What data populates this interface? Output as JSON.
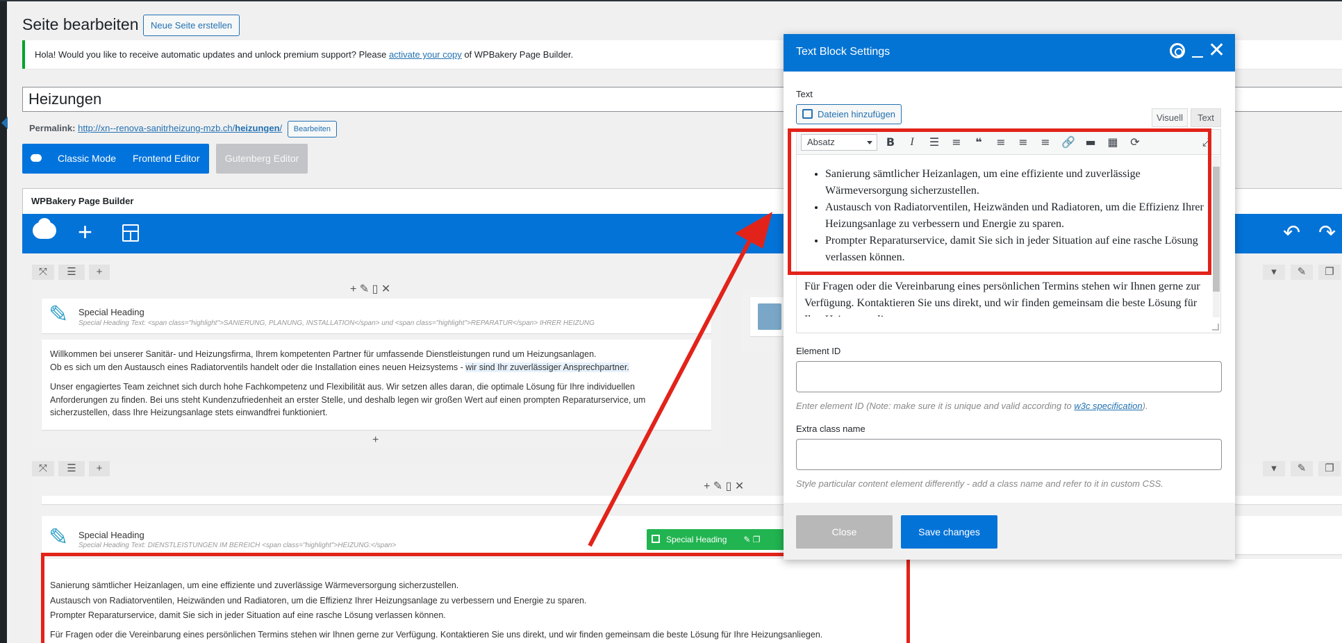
{
  "header": {
    "page_title": "Seite bearbeiten",
    "new_page_label": "Neue Seite erstellen"
  },
  "notice": {
    "text_before": "Hola! Would you like to receive automatic updates and unlock premium support? Please ",
    "link_text": "activate your copy",
    "text_after": " of WPBakery Page Builder."
  },
  "post": {
    "title": "Heizungen",
    "permalink_label": "Permalink:",
    "permalink_base": "http://xn--renova-sanitrheizung-mzb.ch/",
    "permalink_slug": "heizungen",
    "permalink_edit": "Bearbeiten"
  },
  "editor_modes": {
    "classic": "Classic Mode",
    "frontend": "Frontend Editor",
    "gutenberg": "Gutenberg Editor"
  },
  "wpbakery": {
    "title": "WPBakery Page Builder"
  },
  "row1": {
    "heading_title": "Special Heading",
    "heading_sub": "Special Heading Text: <span class=\"highlight\">SANIERUNG, PLANUNG, INSTALLATION</span> und <span class=\"highlight\">REPARATUR</span> IHRER HEIZUNG",
    "p1_line1": "Willkommen bei unserer Sanitär- und Heizungsfirma, Ihrem kompetenten Partner für umfassende Dienstleistungen rund um Heizungsanlagen.",
    "p1_line2_a": "Ob es sich um den Austausch eines Radiatorventils handelt oder die Installation eines neuen Heizsystems - ",
    "p1_line2_hl": "wir sind Ihr zuverlässiger Ansprechpartner.",
    "p2_line1": "Unser engagiertes Team zeichnet sich durch hohe Fachkompetenz und Flexibilität aus. Wir setzen alles daran, die optimale Lösung für Ihre individuellen",
    "p2_line2": "Anforderungen zu finden. Bei uns steht Kundenzufriedenheit an erster Stelle, und deshalb legen wir großen Wert auf einen prompten Reparaturservice, um",
    "p2_line3": "sicherzustellen, dass Ihre Heizungsanlage stets einwandfrei funktioniert."
  },
  "row2": {
    "heading_title": "Special Heading",
    "heading_sub": "Special Heading Text: DIENSTLEISTUNGEN IM BEREICH <span class=\"highlight\">HEIZUNG:</span>",
    "badge_label": "Special Heading",
    "line1": "Sanierung sämtlicher Heizanlagen, um eine effiziente und zuverlässige Wärmeversorgung sicherzustellen.",
    "line2": "Austausch von Radiatorventilen, Heizwänden und Radiatoren, um die Effizienz Ihrer Heizungsanlage zu verbessern und Energie zu sparen.",
    "line3": "Prompter Reparaturservice, damit Sie sich in jeder Situation auf eine rasche Lösung verlassen können.",
    "line4": "Für Fragen oder die Vereinbarung eines persönlichen Termins stehen wir Ihnen gerne zur Verfügung. Kontaktieren Sie uns direkt, und wir finden gemeinsam die beste Lösung für Ihre Heizungsanliegen."
  },
  "modal": {
    "title": "Text Block Settings",
    "text_label": "Text",
    "media_button": "Dateien hinzufügen",
    "tab_visual": "Visuell",
    "tab_text": "Text",
    "format_value": "Absatz",
    "bullet1": "Sanierung sämtlicher Heizanlagen, um eine effiziente und zuverlässige Wärmeversorgung sicherzustellen.",
    "bullet2": "Austausch von Radiatorventilen, Heizwänden und Radiatoren, um die Effizienz Ihrer Heizungsanlage zu verbessern und Energie zu sparen.",
    "bullet3": "Prompter Reparaturservice, damit Sie sich in jeder Situation auf eine rasche Lösung verlassen können.",
    "paragraph": "Für Fragen oder die Vereinbarung eines persönlichen Termins stehen wir Ihnen gerne zur Verfügung. Kontaktieren Sie uns direkt, und wir finden gemeinsam die beste Lösung für Ihre Heizungsanliegen.",
    "element_id_label": "Element ID",
    "element_id_desc_a": "Enter element ID (Note: make sure it is unique and valid according to ",
    "element_id_desc_link": "w3c specification",
    "element_id_desc_b": ").",
    "extra_class_label": "Extra class name",
    "extra_class_desc": "Style particular content element differently - add a class name and refer to it in custom CSS.",
    "close_label": "Close",
    "save_label": "Save changes"
  },
  "colors": {
    "wp_blue": "#2271b1",
    "wpb_blue": "#0473d8",
    "annotation_red": "#e2231a",
    "badge_green": "#21b450"
  }
}
